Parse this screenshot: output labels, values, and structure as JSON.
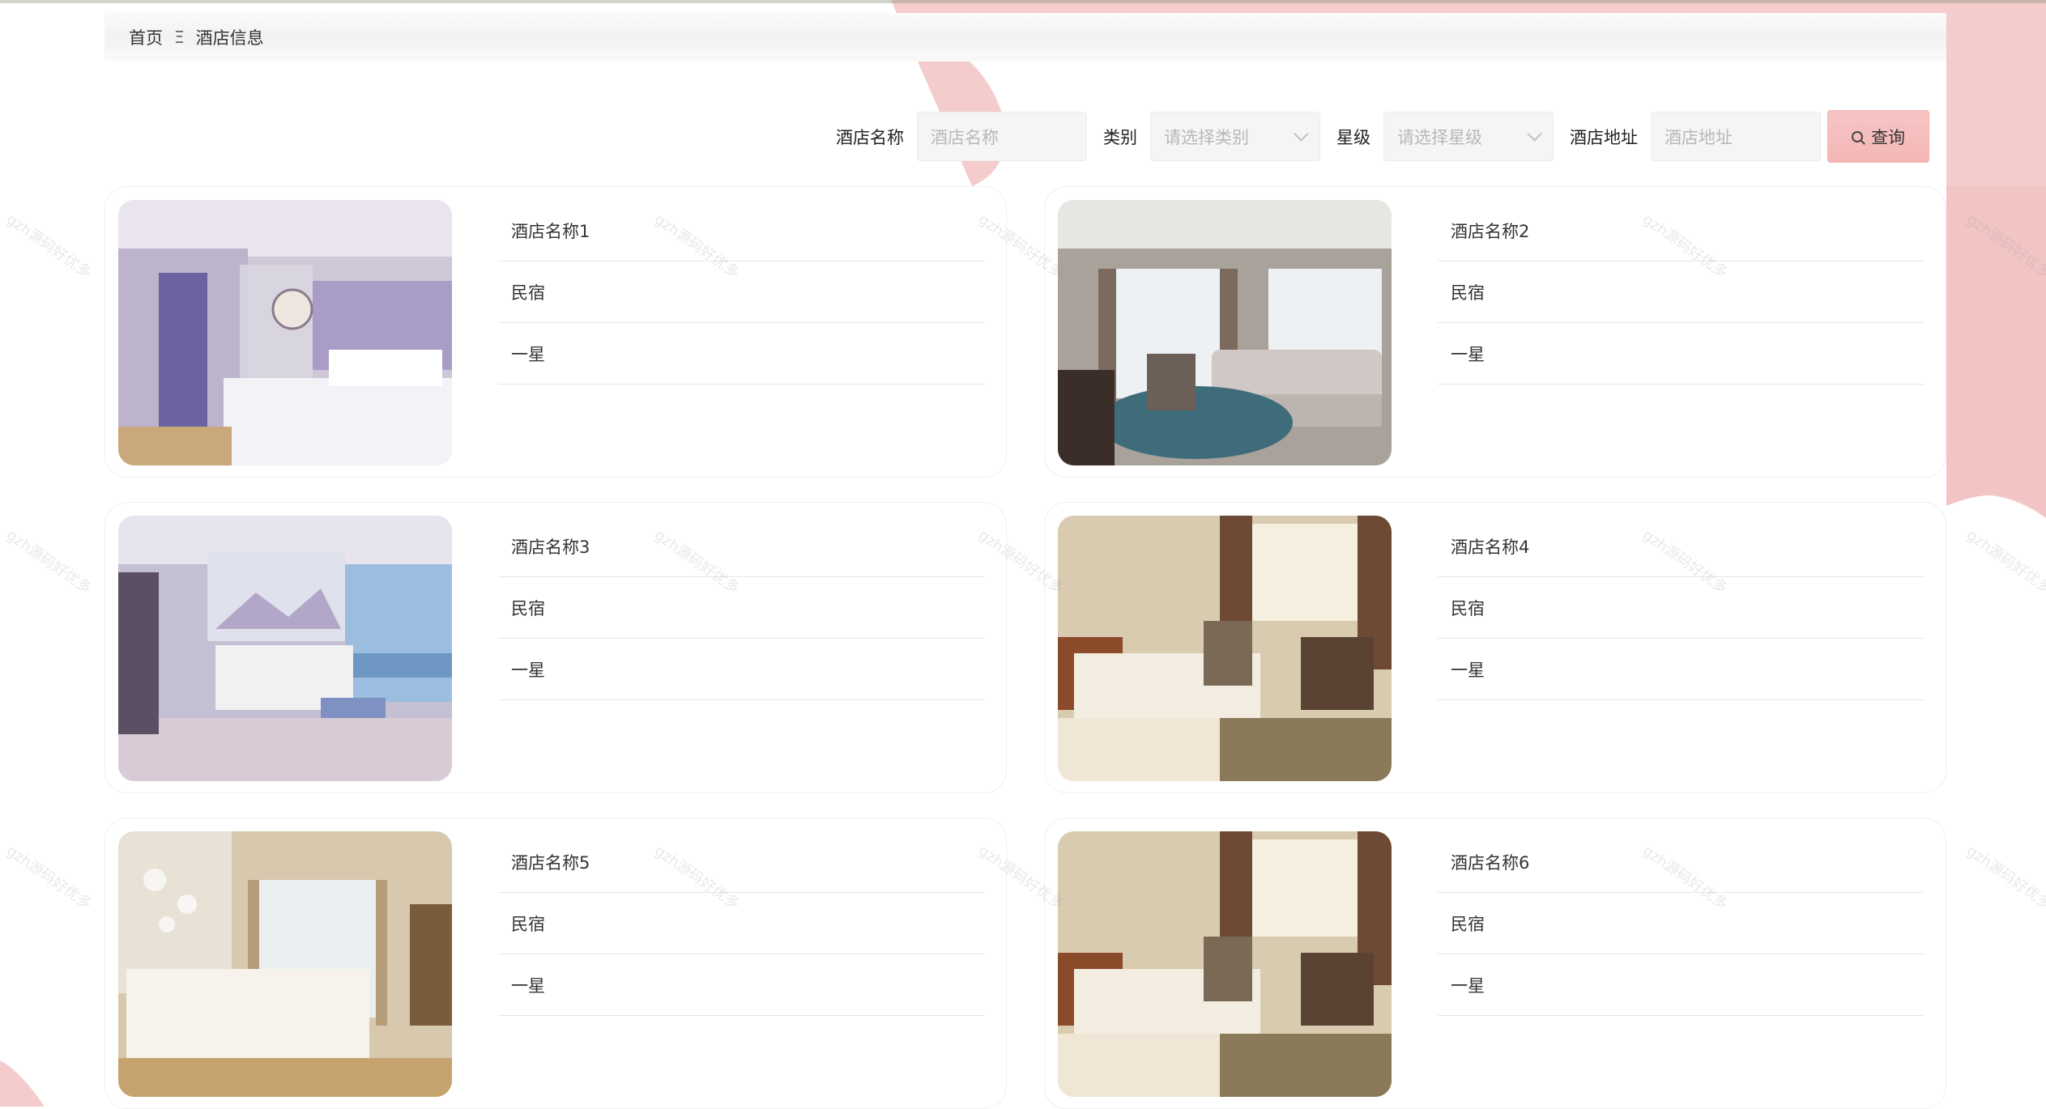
{
  "breadcrumb": {
    "home": "首页",
    "separator": "Ξ",
    "current": "酒店信息"
  },
  "search": {
    "name_label": "酒店名称",
    "name_placeholder": "酒店名称",
    "category_label": "类别",
    "category_placeholder": "请选择类别",
    "star_label": "星级",
    "star_placeholder": "请选择星级",
    "address_label": "酒店地址",
    "address_placeholder": "酒店地址",
    "query_label": "查询"
  },
  "hotels": [
    {
      "name": "酒店名称1",
      "category": "民宿",
      "star": "一星",
      "image": "hotel-room-photo-purple-bedroom"
    },
    {
      "name": "酒店名称2",
      "category": "民宿",
      "star": "一星",
      "image": "hotel-room-photo-lounge-sofa"
    },
    {
      "name": "酒店名称3",
      "category": "民宿",
      "star": "一星",
      "image": "hotel-room-photo-sea-view"
    },
    {
      "name": "酒店名称4",
      "category": "民宿",
      "star": "一星",
      "image": "hotel-room-photo-twin-beds"
    },
    {
      "name": "酒店名称5",
      "category": "民宿",
      "star": "一星",
      "image": "hotel-room-photo-bright-bedroom"
    },
    {
      "name": "酒店名称6",
      "category": "民宿",
      "star": "一星",
      "image": "hotel-room-photo-twin-beds"
    }
  ],
  "watermark": "gzh源码好优多",
  "colors": {
    "accent_pink": "#f4c9c9",
    "button_pink": "#f4b6b6"
  }
}
